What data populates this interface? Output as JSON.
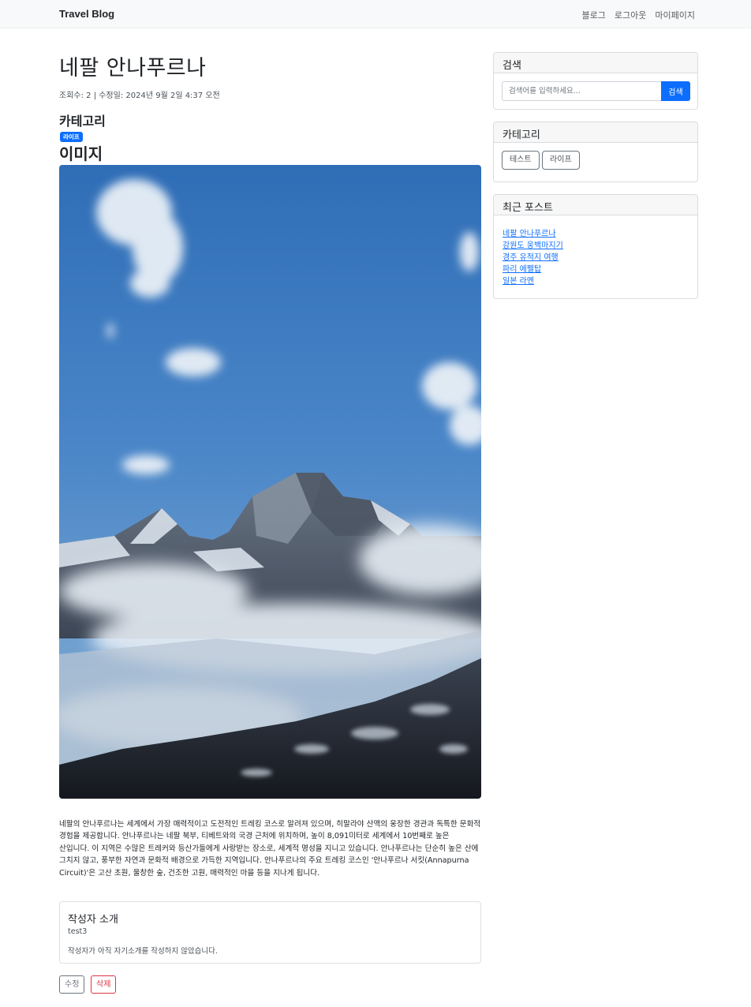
{
  "navbar": {
    "brand": "Travel Blog",
    "links": [
      "블로그",
      "로그아웃",
      "마이페이지"
    ]
  },
  "post": {
    "title": "네팔 안나푸르나",
    "meta": "조회수: 2 | 수정일: 2024년 9월 2일 4:37 오전",
    "category_heading": "카테고리",
    "category_badge": "라이프",
    "image_heading": "이미지",
    "body": "네팔의 안나푸르나는 세계에서 가장 매력적이고 도전적인 트레킹 코스로 알려져 있으며, 히말라야 산맥의 웅장한 경관과 독특한 문화적 경험을 제공합니다. 안나푸르나는 네팔 북부, 티베트와의 국경 근처에 위치하며, 높이 8,091미터로 세계에서 10번째로 높은 산입니다. 이 지역은 수많은 트레커와 등산가들에게 사랑받는 장소로, 세계적 명성을 지니고 있습니다. 안나푸르나는 단순히 높은 산에 그치지 않고, 풍부한 자연과 문화적 배경으로 가득한 지역입니다. 안나푸르나의 주요 트레킹 코스인 '안나푸르나 서킷(Annapurna Circuit)'은 고산 초원, 울창한 숲, 건조한 고원, 매력적인 마을 등을 지나게 됩니다."
  },
  "author": {
    "title": "작성자 소개",
    "name": "test3",
    "bio": "작성자가 아직 자기소개를 작성하지 않았습니다."
  },
  "actions": {
    "edit": "수정",
    "delete": "삭제"
  },
  "sidebar": {
    "search": {
      "title": "검색",
      "placeholder": "검색어를 입력하세요...",
      "button": "검색"
    },
    "categories": {
      "title": "카테고리",
      "items": [
        "테스트",
        "라이프"
      ]
    },
    "recent": {
      "title": "최근 포스트",
      "items": [
        "네팔 안나푸르나",
        "강원도 웅백마지기",
        "경주 유적지 여행",
        "파리 에펠탑",
        "일본 라멘"
      ]
    }
  },
  "colors": {
    "primary": "#0d6efd",
    "danger": "#dc3545",
    "secondary": "#6c757d",
    "navbar_bg": "#f8f9fa"
  }
}
